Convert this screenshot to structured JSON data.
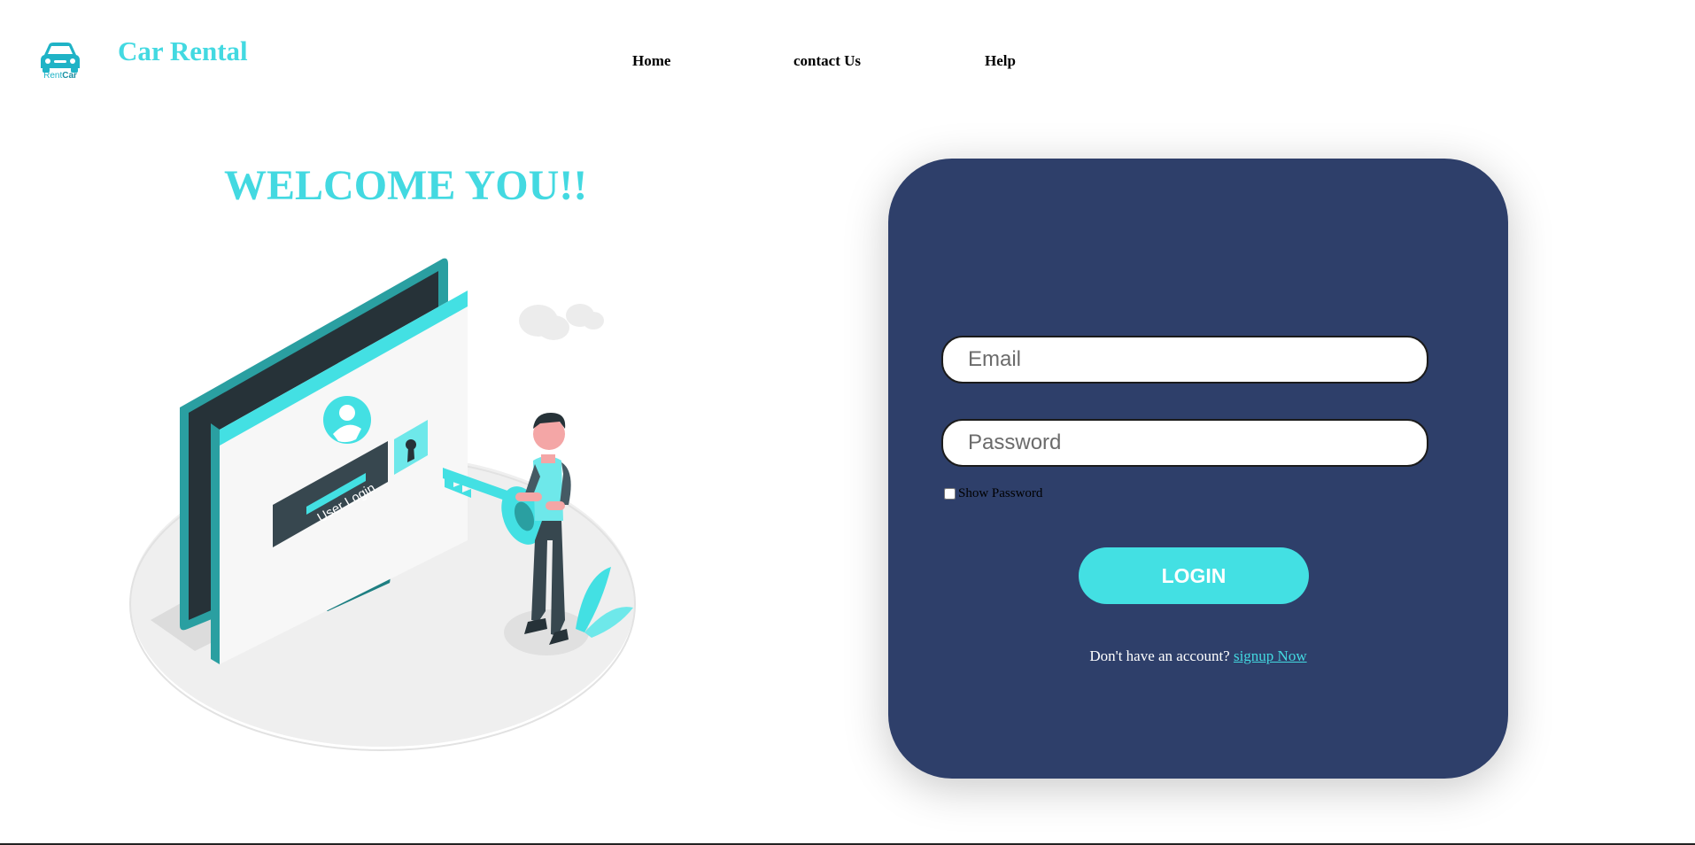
{
  "header": {
    "logo_label_a": "Rent",
    "logo_label_b": "Car",
    "brand": "Car Rental",
    "nav": [
      "Home",
      "contact Us",
      "Help"
    ]
  },
  "hero": {
    "title": "WELCOME YOU!!",
    "screen_label": "User Login"
  },
  "login": {
    "email_placeholder": "Email",
    "password_placeholder": "Password",
    "show_password_label": "Show Password",
    "show_password_checked": false,
    "button_label": "LOGIN",
    "signup_prompt": "Don't have an account?",
    "signup_link": "signup Now"
  },
  "colors": {
    "accent": "#43d9e1",
    "card_bg": "#2e3f6a",
    "button_bg": "#43e0e3"
  }
}
